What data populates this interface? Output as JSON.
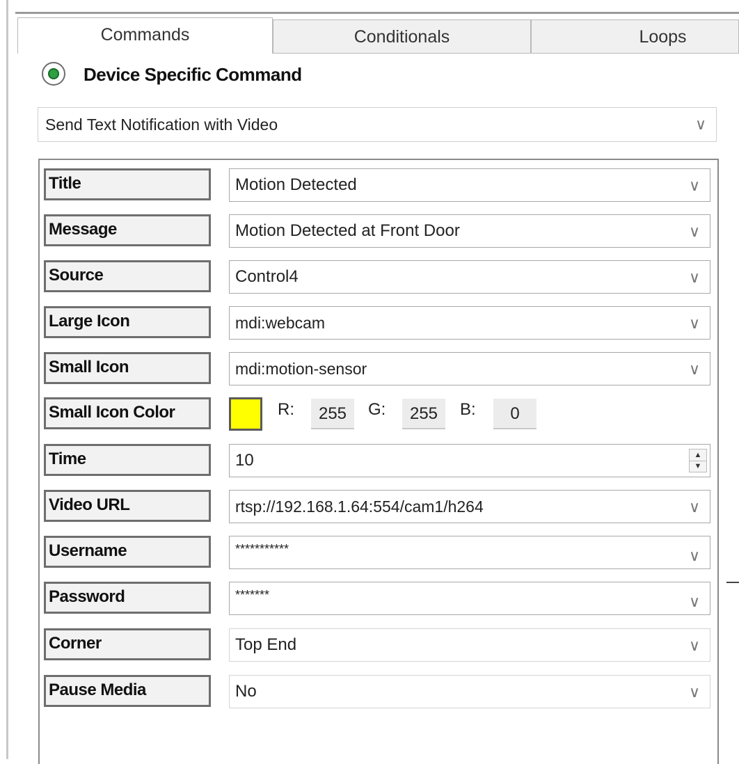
{
  "tabs": [
    {
      "label": "Commands",
      "active": true
    },
    {
      "label": "Conditionals",
      "active": false
    },
    {
      "label": "Loops",
      "active": false
    }
  ],
  "command_type": {
    "label": "Device Specific Command",
    "selected": true
  },
  "command_select": {
    "value": "Send Text Notification with Video"
  },
  "params": {
    "title": {
      "label": "Title",
      "value": "Motion Detected"
    },
    "message": {
      "label": "Message",
      "value": "Motion Detected at Front Door"
    },
    "source": {
      "label": "Source",
      "value": "Control4"
    },
    "large_icon": {
      "label": "Large Icon",
      "value": "mdi:webcam"
    },
    "small_icon": {
      "label": "Small Icon",
      "value": "mdi:motion-sensor"
    },
    "small_icon_color": {
      "label": "Small Icon Color",
      "swatch": "#ffff00",
      "r_label": "R:",
      "r": "255",
      "g_label": "G:",
      "g": "255",
      "b_label": "B:",
      "b": "0"
    },
    "time": {
      "label": "Time",
      "value": "10"
    },
    "video_url": {
      "label": "Video URL",
      "value": "rtsp://192.168.1.64:554/cam1/h264"
    },
    "username": {
      "label": "Username",
      "value": "***********"
    },
    "password": {
      "label": "Password",
      "value": "*******"
    },
    "corner": {
      "label": "Corner",
      "value": "Top End"
    },
    "pause_media": {
      "label": "Pause Media",
      "value": "No"
    }
  },
  "icons": {
    "dropdown": "chevron-down-icon",
    "spinner": "spinner-arrows-icon"
  }
}
